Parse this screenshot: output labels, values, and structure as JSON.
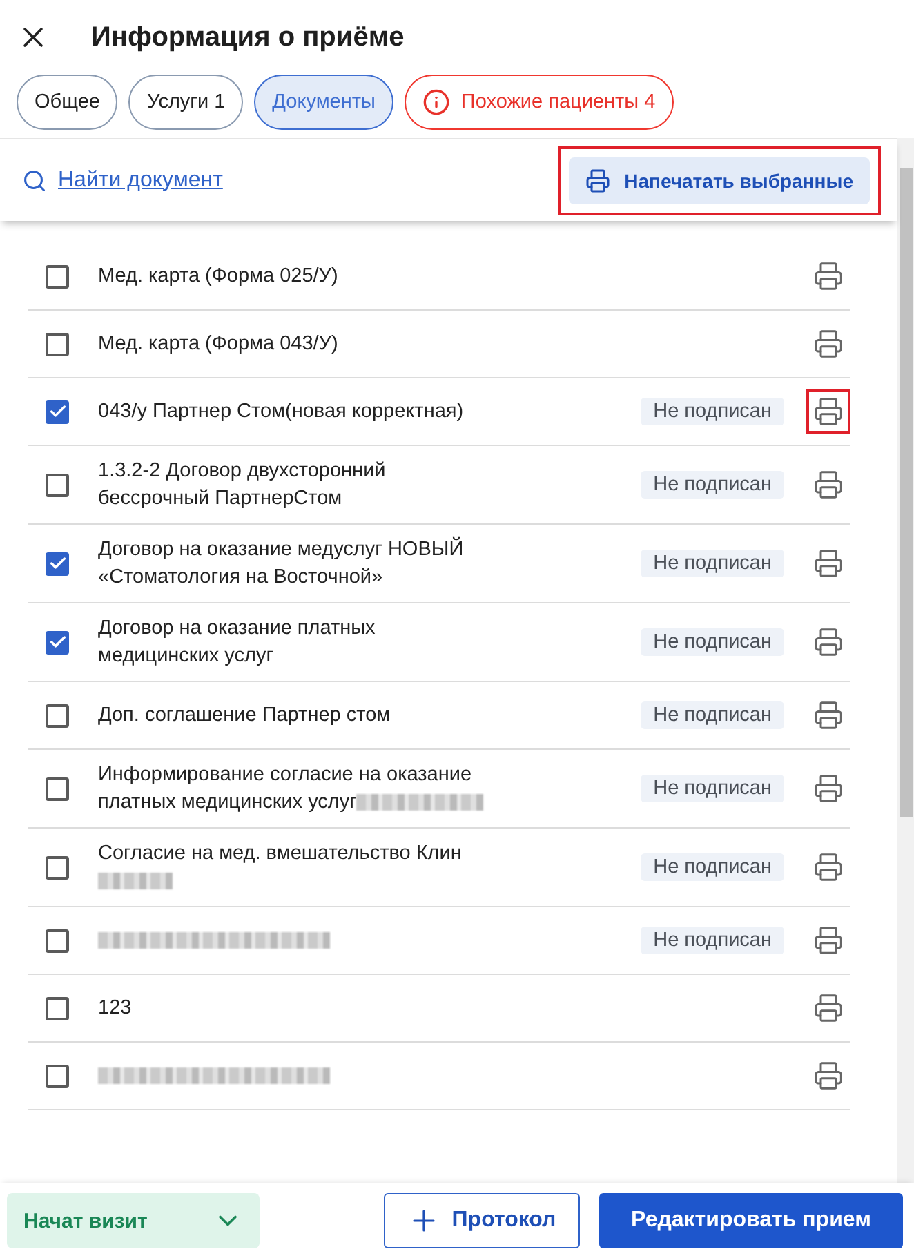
{
  "header": {
    "title": "Информация о приёме"
  },
  "tabs": [
    {
      "label": "Общее",
      "selected": false,
      "kind": "plain"
    },
    {
      "label": "Услуги 1",
      "selected": false,
      "kind": "plain"
    },
    {
      "label": "Документы",
      "selected": true,
      "kind": "plain"
    },
    {
      "label": "Похожие пациенты 4",
      "selected": false,
      "kind": "alert"
    }
  ],
  "toolbar": {
    "search_link": "Найти документ",
    "print_selected": {
      "label": "Напечатать выбранные",
      "highlighted": true
    }
  },
  "documents": [
    {
      "kind": "plain",
      "name": "Мед. карта (Форма 025/У)",
      "checked": false,
      "print_highlighted": false
    },
    {
      "kind": "plain",
      "name": "Мед. карта (Форма 043/У)",
      "checked": false,
      "print_highlighted": false
    },
    {
      "kind": "plain",
      "name": "043/у Партнер Стом(новая корректная)",
      "checked": true,
      "status": "Не подписан",
      "print_highlighted": true
    },
    {
      "kind": "plain",
      "name": "1.3.2-2 Договор двухсторонний бессрочный ПартнерСтом",
      "checked": false,
      "status": "Не подписан",
      "print_highlighted": false
    },
    {
      "kind": "plain",
      "name": "Договор на оказание медуслуг НОВЫЙ «Стоматология на Восточной»",
      "checked": true,
      "status": "Не подписан",
      "print_highlighted": false
    },
    {
      "kind": "plain",
      "name": "Договор на оказание платных медицинских услуг",
      "checked": true,
      "status": "Не подписан",
      "print_highlighted": false
    },
    {
      "kind": "plain",
      "name": "Доп. соглашение Партнер стом",
      "checked": false,
      "status": "Не подписан",
      "print_highlighted": false
    },
    {
      "kind": "tailblur",
      "name": "Информирование согласие на оказание платных медицинских услуг",
      "checked": false,
      "status": "Не подписан",
      "print_highlighted": false
    },
    {
      "kind": "blurline",
      "name": "Согласие на мед. вмешательство Клин",
      "checked": false,
      "status": "Не подписан",
      "print_highlighted": false
    },
    {
      "kind": "blurred",
      "checked": false,
      "status": "Не подписан",
      "print_highlighted": false
    },
    {
      "kind": "plain",
      "name": "123",
      "checked": false,
      "print_highlighted": false
    },
    {
      "kind": "blurred",
      "checked": false,
      "print_highlighted": false
    }
  ],
  "footer": {
    "status_menu": "Начат визит",
    "protocol_button": "Протокол",
    "edit_button": "Редактировать прием"
  }
}
